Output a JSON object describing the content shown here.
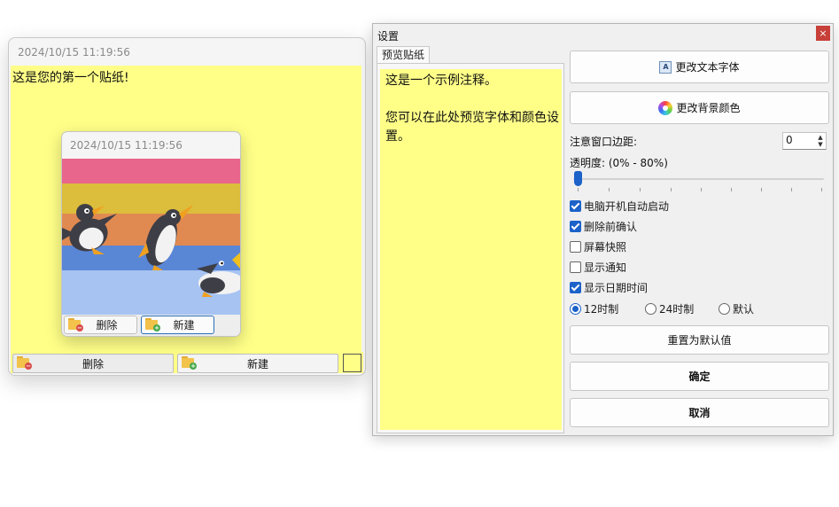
{
  "note": {
    "timestamp": "2024/10/15 11:19:56",
    "content": "这是您的第一个贴纸!",
    "delete_label": "删除",
    "new_label": "新建",
    "bg_color": "#ffff88"
  },
  "image_note": {
    "timestamp": "2024/10/15 11:19:56",
    "delete_label": "删除",
    "new_label": "新建",
    "stripe_colors": [
      "#e8658c",
      "#dcbd3c",
      "#e08a52",
      "#5a86d6",
      "#a6c3f2"
    ]
  },
  "settings": {
    "title": "设置",
    "close_symbol": "×",
    "tab_label": "预览贴纸",
    "preview_text_line1": "这是一个示例注释。",
    "preview_text_line2": "您可以在此处预览字体和颜色设置。",
    "change_font_label": "更改文本字体",
    "change_bg_label": "更改背景颜色",
    "margin_label": "注意窗口边距:",
    "margin_value": "0",
    "opacity_label": "透明度: (0% - 80%)",
    "opacity_value": 0,
    "checkboxes": [
      {
        "label": "电脑开机自动启动",
        "checked": true
      },
      {
        "label": "删除前确认",
        "checked": true
      },
      {
        "label": "屏幕快照",
        "checked": false
      },
      {
        "label": "显示通知",
        "checked": false
      },
      {
        "label": "显示日期时间",
        "checked": true
      }
    ],
    "time_format": {
      "options": [
        "12时制",
        "24时制",
        "默认"
      ],
      "selected": "12时制"
    },
    "reset_label": "重置为默认值",
    "ok_label": "确定",
    "cancel_label": "取消",
    "accent_color": "#1b62c9"
  }
}
